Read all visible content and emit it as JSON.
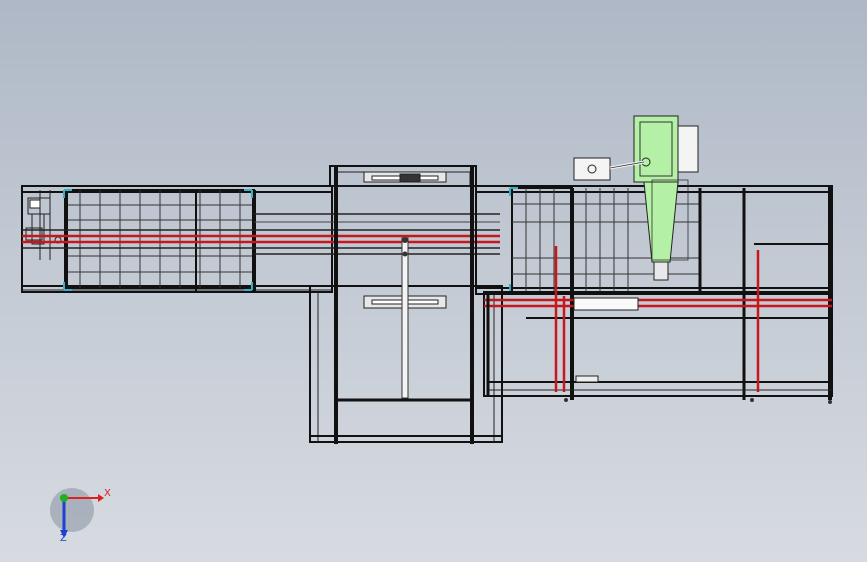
{
  "colors": {
    "background_top": "#aeb8c6",
    "background_bottom": "#d7dbe1",
    "frame": "#111111",
    "red_rail": "#c8161d",
    "motor_green": "#b4f0a6",
    "corner_bracket": "#3ab0c8",
    "axis_x": "#e02020",
    "axis_y": "#20b020",
    "axis_z": "#2040d0"
  },
  "triad": {
    "x_label": "X",
    "z_label": "Z",
    "x_icon": "x-axis-arrow",
    "y_icon": "y-axis-dot",
    "z_icon": "z-axis-arrow"
  }
}
